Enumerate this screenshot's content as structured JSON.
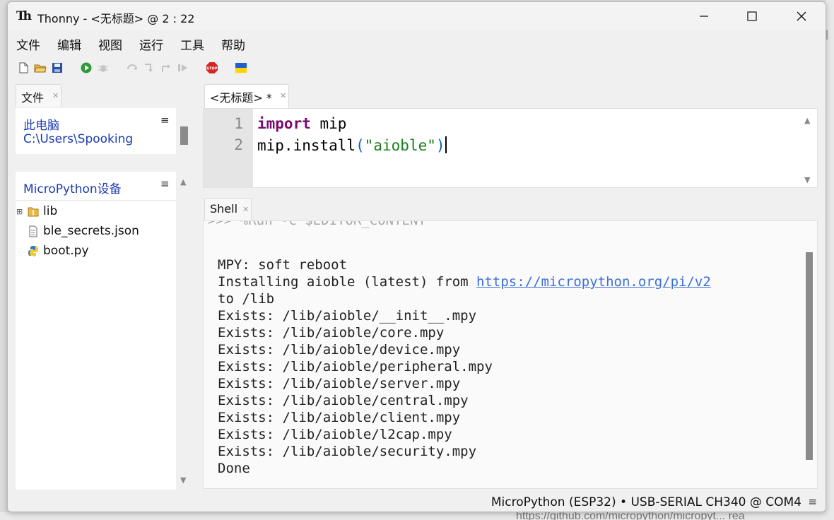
{
  "window": {
    "title": "Thonny  -  <无标题>  @  2 : 22"
  },
  "menu": [
    "文件",
    "编辑",
    "视图",
    "运行",
    "工具",
    "帮助"
  ],
  "toolbar": {
    "icons": [
      "new-file-icon",
      "open-file-icon",
      "save-icon",
      "run-icon",
      "debug-icon",
      "step-over-icon",
      "step-into-icon",
      "step-out-icon",
      "resume-icon",
      "stop-icon",
      "ukraine-flag-icon"
    ]
  },
  "files": {
    "tab_label": "文件",
    "this_pc": {
      "title": "此电脑",
      "path": "C:\\Users\\Spooking"
    },
    "device": {
      "title": "MicroPython设备",
      "items": [
        {
          "name": "lib",
          "type": "folder"
        },
        {
          "name": "ble_secrets.json",
          "type": "file"
        },
        {
          "name": "boot.py",
          "type": "python"
        }
      ]
    }
  },
  "editor": {
    "tab_label": "<无标题> *",
    "line_numbers": [
      "1",
      "2"
    ],
    "line1": {
      "keyword": "import",
      "rest": " mip"
    },
    "line2": {
      "prefix": "mip.install",
      "open": "(",
      "string": "\"aioble\"",
      "close": ")"
    }
  },
  "shell": {
    "tab_label": "Shell",
    "partial_top": ">>> %Run -c $EDITOR_CONTENT",
    "lines": [
      "MPY: soft reboot",
      "Installing aioble (latest) from ",
      "to /lib",
      "Exists: /lib/aioble/__init__.mpy",
      "Exists: /lib/aioble/core.mpy",
      "Exists: /lib/aioble/device.mpy",
      "Exists: /lib/aioble/peripheral.mpy",
      "Exists: /lib/aioble/server.mpy",
      "Exists: /lib/aioble/central.mpy",
      "Exists: /lib/aioble/client.mpy",
      "Exists: /lib/aioble/l2cap.mpy",
      "Exists: /lib/aioble/security.mpy",
      "Done"
    ],
    "link": "https://micropython.org/pi/v2"
  },
  "status": {
    "interpreter": "MicroPython (ESP32)  •  USB-SERIAL CH340 @ COM4"
  },
  "background": {
    "bottom_text": "https://github.com/micropython/micropyt...  rea",
    "right_text": "ol"
  }
}
